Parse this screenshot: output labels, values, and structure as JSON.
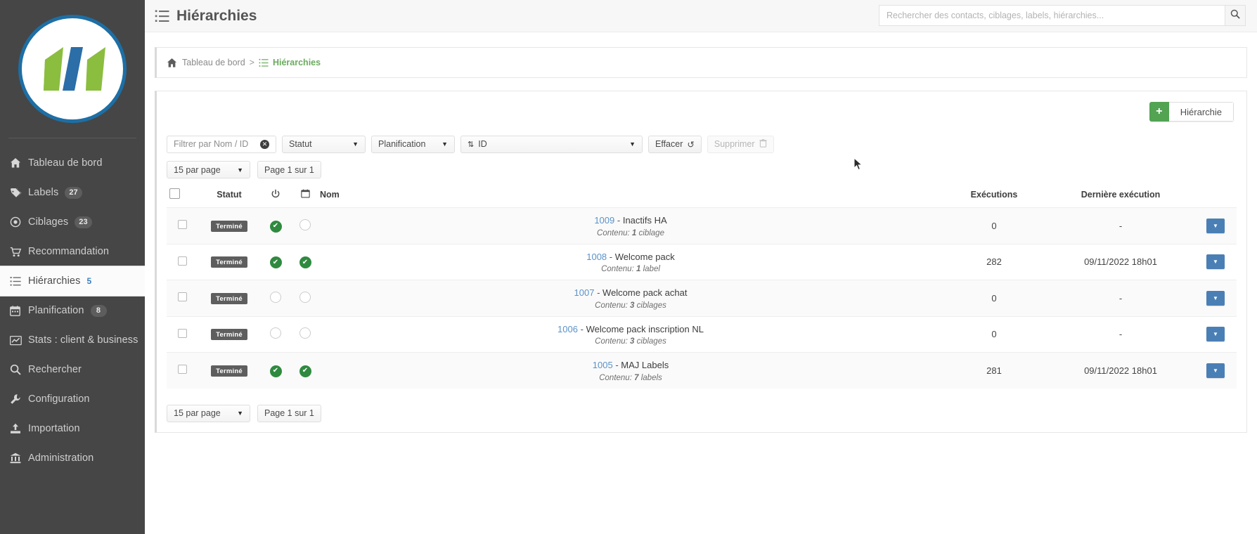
{
  "sidebar": {
    "logo_alt": "logo-1-1",
    "items": [
      {
        "label": "Tableau de bord",
        "icon": "home-icon",
        "badge": "",
        "active": false
      },
      {
        "label": "Labels",
        "icon": "tag-icon",
        "badge": "27",
        "active": false
      },
      {
        "label": "Ciblages",
        "icon": "target-icon",
        "badge": "23",
        "active": false
      },
      {
        "label": "Recommandation",
        "icon": "cart-icon",
        "badge": "",
        "active": false
      },
      {
        "label": "Hiérarchies",
        "icon": "list-icon",
        "badge": "5",
        "active": true
      },
      {
        "label": "Planification",
        "icon": "calendar-icon",
        "badge": "8",
        "active": false
      },
      {
        "label": "Stats : client & business",
        "icon": "chart-icon",
        "badge": "",
        "active": false
      },
      {
        "label": "Rechercher",
        "icon": "search-icon",
        "badge": "",
        "active": false
      },
      {
        "label": "Configuration",
        "icon": "wrench-icon",
        "badge": "",
        "active": false
      },
      {
        "label": "Importation",
        "icon": "upload-icon",
        "badge": "",
        "active": false
      },
      {
        "label": "Administration",
        "icon": "bank-icon",
        "badge": "",
        "active": false
      }
    ]
  },
  "header": {
    "title": "Hiérarchies",
    "title_icon": "list-icon",
    "search_placeholder": "Rechercher des contacts, ciblages, labels, hiérarchies...",
    "search_value": "",
    "search_button_icon": "search-icon"
  },
  "breadcrumb": {
    "home_icon": "home-icon",
    "home_label": "Tableau de bord",
    "separator": ">",
    "current_icon": "list-icon",
    "current_label": "Hiérarchies"
  },
  "toolbar": {
    "add_button_label": "Hiérarchie",
    "add_button_plus": "+",
    "filter_placeholder": "Filtrer par Nom / ID",
    "filter_value": "",
    "clear_input_icon": "clear-circle-icon",
    "statut_select": "Statut",
    "planification_select": "Planification",
    "sort_select": "ID",
    "sort_icon": "sort-arrows-icon",
    "effacer_label": "Effacer",
    "effacer_icon": "undo-icon",
    "supprimer_label": "Supprimer",
    "supprimer_icon": "trash-icon",
    "supprimer_disabled": true
  },
  "pagination": {
    "per_page": "15 par page",
    "page_info": "Page 1 sur 1"
  },
  "table": {
    "columns": {
      "select_all": "select-all-checkbox",
      "statut": "Statut",
      "power": "power-icon",
      "calendar": "calendar-icon",
      "nom": "Nom",
      "executions": "Exécutions",
      "derniere": "Dernière exécution"
    },
    "rows": [
      {
        "checked": false,
        "statut": "Terminé",
        "power_on": true,
        "planif_on": false,
        "id": "1009",
        "dash": "-",
        "name": "Inactifs HA",
        "contenu_label": "Contenu:",
        "contenu_count": "1",
        "contenu_type": "ciblage",
        "executions": "0",
        "derniere": "-",
        "action_icon": "chevron-down-icon"
      },
      {
        "checked": false,
        "statut": "Terminé",
        "power_on": true,
        "planif_on": true,
        "id": "1008",
        "dash": "-",
        "name": "Welcome pack",
        "contenu_label": "Contenu:",
        "contenu_count": "1",
        "contenu_type": "label",
        "executions": "282",
        "derniere": "09/11/2022 18h01",
        "action_icon": "chevron-down-icon"
      },
      {
        "checked": false,
        "statut": "Terminé",
        "power_on": false,
        "planif_on": false,
        "id": "1007",
        "dash": "-",
        "name": "Welcome pack achat",
        "contenu_label": "Contenu:",
        "contenu_count": "3",
        "contenu_type": "ciblages",
        "executions": "0",
        "derniere": "-",
        "action_icon": "chevron-down-icon"
      },
      {
        "checked": false,
        "statut": "Terminé",
        "power_on": false,
        "planif_on": false,
        "id": "1006",
        "dash": "-",
        "name": "Welcome pack inscription NL",
        "contenu_label": "Contenu:",
        "contenu_count": "3",
        "contenu_type": "ciblages",
        "executions": "0",
        "derniere": "-",
        "action_icon": "chevron-down-icon"
      },
      {
        "checked": false,
        "statut": "Terminé",
        "power_on": true,
        "planif_on": true,
        "id": "1005",
        "dash": "-",
        "name": "MAJ Labels",
        "contenu_label": "Contenu:",
        "contenu_count": "7",
        "contenu_type": "labels",
        "executions": "281",
        "derniere": "09/11/2022 18h01",
        "action_icon": "chevron-down-icon"
      }
    ]
  },
  "colors": {
    "sidebar_bg": "#464646",
    "accent_green": "#6aab5e",
    "status_green": "#2f8a3f",
    "link_blue": "#5b92c9",
    "action_blue": "#4a7fb5",
    "logo_blue": "#1d6fa5",
    "logo_green": "#8bbd3f"
  }
}
